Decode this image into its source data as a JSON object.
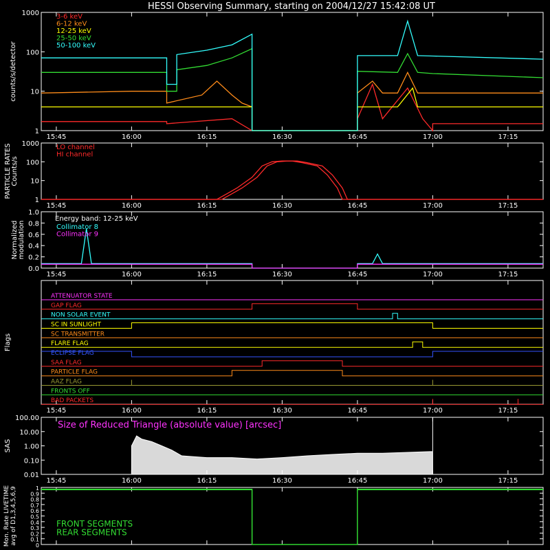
{
  "title": "HESSI Observing Summary, starting on 2004/12/27 15:42:08 UT",
  "colors": {
    "axis": "#ffffff",
    "red": "#ff2a2a",
    "orange": "#ff8c1a",
    "yellow": "#ffff00",
    "green": "#33dd33",
    "cyan": "#33ffff",
    "magenta": "#ff33ff",
    "blue": "#3355ff",
    "olive": "#999933"
  },
  "chart_data": [
    {
      "type": "line",
      "id": "counts",
      "ylabel": "counts/s/detector",
      "yscale": "log",
      "ylim": [
        1,
        1000
      ],
      "yticks": [
        "1",
        "10",
        "100",
        "1000"
      ],
      "xlim": [
        "15:42",
        "17:22"
      ],
      "xticks": [
        "15:45",
        "16:00",
        "16:15",
        "16:30",
        "16:45",
        "17:00",
        "17:15"
      ],
      "series": [
        {
          "name": "3-6 keV",
          "color": "red",
          "x": [
            "15:42",
            "16:07",
            "16:07",
            "16:20",
            "16:24",
            "16:24",
            "16:45",
            "16:45",
            "16:48",
            "16:50",
            "16:55",
            "16:58",
            "17:00",
            "17:00",
            "17:22"
          ],
          "values": [
            1.7,
            1.7,
            1.5,
            2.0,
            1.0,
            1.0,
            1.0,
            2.0,
            15,
            2.0,
            12,
            2.0,
            1.0,
            1.5,
            1.5
          ]
        },
        {
          "name": "6-12 keV",
          "color": "orange",
          "x": [
            "15:42",
            "16:00",
            "16:07",
            "16:07",
            "16:14",
            "16:17",
            "16:20",
            "16:22",
            "16:24",
            "16:24",
            "16:45",
            "16:45",
            "16:48",
            "16:50",
            "16:53",
            "16:55",
            "16:57",
            "16:59",
            "17:22"
          ],
          "values": [
            9,
            10,
            10,
            5,
            8,
            18,
            8,
            5,
            4,
            1.0,
            1.0,
            9,
            18,
            9,
            9,
            30,
            9,
            9,
            9
          ]
        },
        {
          "name": "12-25 keV",
          "color": "yellow",
          "x": [
            "15:42",
            "16:24",
            "16:24",
            "16:45",
            "16:45",
            "16:53",
            "16:56",
            "16:57",
            "16:58",
            "17:22"
          ],
          "values": [
            4,
            4,
            1.0,
            1.0,
            4,
            4,
            12,
            4,
            4,
            4
          ]
        },
        {
          "name": "25-50 keV",
          "color": "green",
          "x": [
            "15:42",
            "16:07",
            "16:07",
            "16:09",
            "16:09",
            "16:15",
            "16:20",
            "16:24",
            "16:24",
            "16:45",
            "16:45",
            "16:53",
            "16:55",
            "16:57",
            "17:00",
            "17:22"
          ],
          "values": [
            30,
            30,
            10,
            10,
            35,
            45,
            70,
            120,
            1.0,
            1.0,
            32,
            30,
            90,
            30,
            28,
            22
          ]
        },
        {
          "name": "50-100 keV",
          "color": "cyan",
          "x": [
            "15:42",
            "16:07",
            "16:07",
            "16:09",
            "16:09",
            "16:15",
            "16:20",
            "16:24",
            "16:24",
            "16:45",
            "16:45",
            "16:53",
            "16:55",
            "16:57",
            "17:00",
            "17:22"
          ],
          "values": [
            70,
            70,
            15,
            15,
            85,
            110,
            150,
            280,
            1.0,
            1.0,
            80,
            80,
            600,
            80,
            78,
            65
          ]
        }
      ]
    },
    {
      "type": "line",
      "id": "particle",
      "ylabel": "PARTICLE RATES Counts/s",
      "yscale": "log",
      "ylim": [
        1,
        1000
      ],
      "yticks": [
        "1",
        "10",
        "100",
        "1000"
      ],
      "xlim": [
        "15:42",
        "17:22"
      ],
      "xticks": [
        "15:45",
        "16:00",
        "16:15",
        "16:30",
        "16:45",
        "17:00",
        "17:15"
      ],
      "series": [
        {
          "name": "LO channel",
          "color": "red",
          "x": [
            "15:42",
            "16:17",
            "16:19",
            "16:21",
            "16:24",
            "16:26",
            "16:28",
            "16:30",
            "16:32",
            "16:34",
            "16:37",
            "16:39",
            "16:41",
            "16:42",
            "17:22"
          ],
          "values": [
            1,
            1,
            2,
            4,
            15,
            60,
            100,
            110,
            110,
            90,
            60,
            20,
            4,
            1,
            1
          ]
        },
        {
          "name": "HI channel",
          "color": "red",
          "x": [
            "15:42",
            "16:18",
            "16:20",
            "16:22",
            "16:25",
            "16:27",
            "16:29",
            "16:31",
            "16:33",
            "16:35",
            "16:38",
            "16:40",
            "16:42",
            "16:43",
            "17:22"
          ],
          "values": [
            1,
            1,
            2,
            4,
            15,
            60,
            100,
            110,
            110,
            90,
            60,
            20,
            4,
            1,
            1
          ]
        }
      ]
    },
    {
      "type": "line",
      "id": "modulation",
      "ylabel": "Normalized modulation",
      "ylim": [
        0,
        1.0
      ],
      "yticks": [
        "0.0",
        "0.2",
        "0.4",
        "0.6",
        "0.8",
        "1.0"
      ],
      "xlim": [
        "15:42",
        "17:22"
      ],
      "xticks": [
        "15:45",
        "16:00",
        "16:15",
        "16:30",
        "16:45",
        "17:00",
        "17:15"
      ],
      "annotation": "Energy band: 12-25 keV",
      "series": [
        {
          "name": "Collimator 8",
          "color": "cyan",
          "x": [
            "15:42",
            "15:50",
            "15:51",
            "15:52",
            "16:24",
            "16:24",
            "16:45",
            "16:45",
            "16:48",
            "16:49",
            "16:50",
            "17:22"
          ],
          "values": [
            0.08,
            0.08,
            0.7,
            0.08,
            0.08,
            0.0,
            0.0,
            0.08,
            0.08,
            0.25,
            0.08,
            0.08
          ]
        },
        {
          "name": "Collimator 9",
          "color": "magenta",
          "x": [
            "15:42",
            "16:24",
            "16:24",
            "16:45",
            "16:45",
            "17:22"
          ],
          "values": [
            0.07,
            0.07,
            0.0,
            0.0,
            0.07,
            0.07
          ]
        }
      ]
    },
    {
      "type": "line",
      "id": "flags",
      "ylabel": "Flags",
      "xlim": [
        "15:42",
        "17:22"
      ],
      "xticks": [
        "15:45",
        "16:00",
        "16:15",
        "16:30",
        "16:45",
        "17:00",
        "17:15"
      ],
      "series": [
        {
          "name": "ATTENUATOR STATE",
          "color": "magenta",
          "x": [
            "15:42",
            "17:22"
          ],
          "values": [
            0,
            0
          ]
        },
        {
          "name": "GAP FLAG",
          "color": "red",
          "x": [
            "15:42",
            "16:24",
            "16:24",
            "16:45",
            "16:45",
            "17:22"
          ],
          "values": [
            0,
            0,
            1,
            1,
            0,
            0
          ]
        },
        {
          "name": "NON SOLAR EVENT",
          "color": "cyan",
          "x": [
            "15:42",
            "16:52",
            "16:52",
            "16:53",
            "16:53",
            "17:22"
          ],
          "values": [
            0,
            0,
            1,
            1,
            0,
            0
          ]
        },
        {
          "name": "SC IN SUNLIGHT",
          "color": "yellow",
          "x": [
            "15:42",
            "16:00",
            "16:00",
            "17:00",
            "17:00",
            "17:22"
          ],
          "values": [
            0,
            0,
            1,
            1,
            0,
            0
          ]
        },
        {
          "name": "SC TRANSMITTER",
          "color": "orange",
          "x": [
            "15:42",
            "17:22"
          ],
          "values": [
            0,
            0
          ]
        },
        {
          "name": "FLARE FLAG",
          "color": "yellow",
          "x": [
            "15:42",
            "16:56",
            "16:56",
            "16:58",
            "16:58",
            "17:22"
          ],
          "values": [
            0,
            0,
            1,
            1,
            0,
            0
          ]
        },
        {
          "name": "ECLIPSE FLAG",
          "color": "blue",
          "x": [
            "15:42",
            "16:00",
            "16:00",
            "17:00",
            "17:00",
            "17:22"
          ],
          "values": [
            1,
            1,
            0,
            0,
            1,
            1
          ]
        },
        {
          "name": "SAA FLAG",
          "color": "red",
          "x": [
            "15:42",
            "16:26",
            "16:26",
            "16:42",
            "16:42",
            "17:22"
          ],
          "values": [
            0,
            0,
            1,
            1,
            0,
            0
          ]
        },
        {
          "name": "PARTICLE FLAG",
          "color": "orange",
          "x": [
            "15:42",
            "16:20",
            "16:20",
            "16:42",
            "16:42",
            "17:22"
          ],
          "values": [
            0,
            0,
            1,
            1,
            0,
            0
          ]
        },
        {
          "name": "AAZ FLAG",
          "color": "olive",
          "x": [
            "15:42",
            "16:00",
            "16:00",
            "16:00",
            "17:00",
            "17:00",
            "17:00",
            "17:22"
          ],
          "values": [
            0,
            0,
            1,
            0,
            0,
            1,
            0,
            0
          ]
        },
        {
          "name": "FRONTS OFF",
          "color": "green",
          "x": [
            "15:42",
            "17:22"
          ],
          "values": [
            0,
            0
          ]
        },
        {
          "name": "BAD PACKETS",
          "color": "red",
          "x": [
            "15:42",
            "17:00",
            "17:00",
            "17:00",
            "17:17",
            "17:17",
            "17:17",
            "17:22"
          ],
          "values": [
            0,
            0,
            1,
            0,
            0,
            1,
            0,
            0
          ]
        }
      ]
    },
    {
      "type": "line",
      "id": "sas",
      "ylabel": "SAS",
      "yscale": "log",
      "ylim": [
        0.01,
        100
      ],
      "yticks": [
        "0.01",
        "0.10",
        "1.00",
        "10.00",
        "100.00"
      ],
      "xlim": [
        "15:42",
        "17:22"
      ],
      "xticks": [
        "15:45",
        "16:00",
        "16:15",
        "16:30",
        "16:45",
        "17:00",
        "17:15"
      ],
      "annotation": "Size of Reduced Triangle (absolute value) [arcsec]",
      "series": [
        {
          "name": "",
          "color": "axis",
          "x": [
            "16:00",
            "16:01",
            "16:02",
            "16:04",
            "16:06",
            "16:08",
            "16:10",
            "16:15",
            "16:20",
            "16:25",
            "16:30",
            "16:35",
            "16:40",
            "16:45",
            "16:50",
            "16:55",
            "17:00",
            "17:00"
          ],
          "values": [
            1.0,
            5.0,
            3.0,
            2.0,
            1.0,
            0.5,
            0.2,
            0.15,
            0.15,
            0.12,
            0.15,
            0.2,
            0.25,
            0.3,
            0.3,
            0.35,
            0.4,
            100
          ]
        }
      ]
    },
    {
      "type": "line",
      "id": "livetime",
      "ylabel": "Mon. Rate LIVETIME avg of D1,3,4,5,6,9",
      "ylim": [
        0,
        1.0
      ],
      "yticks": [
        "0",
        "0.1",
        "0.2",
        "0.3",
        "0.4",
        "0.5",
        "0.6",
        "0.7",
        "0.8",
        "0.9",
        "1"
      ],
      "xlim": [
        "15:42",
        "17:22"
      ],
      "series": [
        {
          "name": "FRONT SEGMENTS",
          "color": "green",
          "x": [
            "15:42",
            "16:24",
            "16:24",
            "16:45",
            "16:45",
            "17:22"
          ],
          "values": [
            0.97,
            0.97,
            0.0,
            0.0,
            0.97,
            0.97
          ]
        },
        {
          "name": "REAR SEGMENTS",
          "color": "green",
          "x": [
            "15:42",
            "16:24",
            "16:24",
            "16:45",
            "16:45",
            "17:22"
          ],
          "values": [
            0.96,
            0.96,
            0.0,
            0.0,
            0.96,
            0.96
          ]
        }
      ]
    }
  ]
}
